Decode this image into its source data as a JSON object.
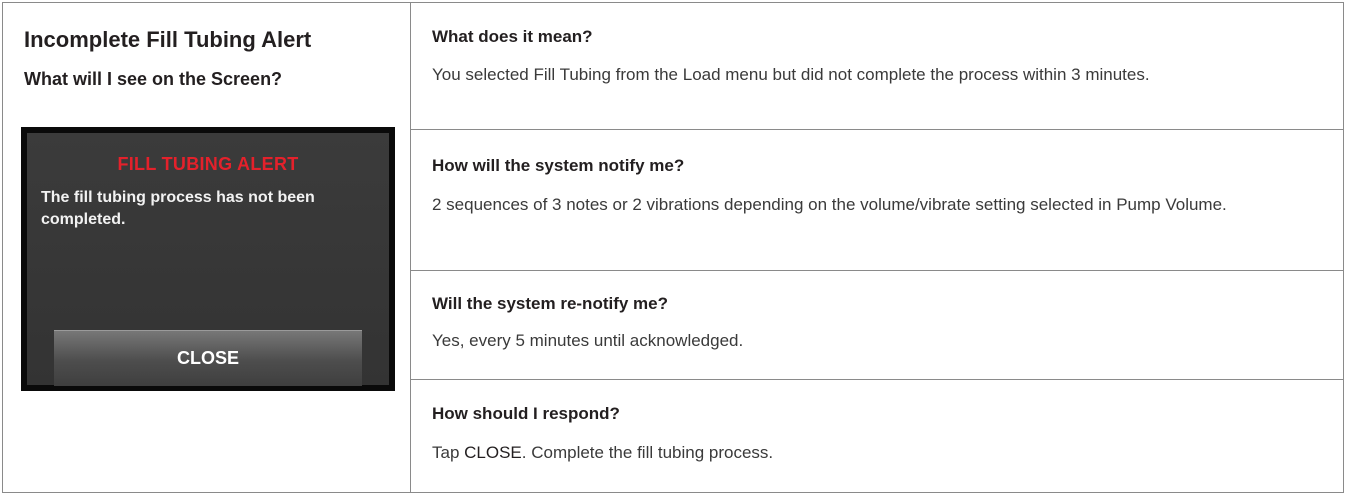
{
  "left": {
    "title": "Incomplete Fill Tubing Alert",
    "screen_question": "What will I see on the Screen?",
    "device": {
      "header": "FILL TUBING ALERT",
      "message": "The fill tubing process has not been completed.",
      "close_label": "CLOSE"
    }
  },
  "sections": [
    {
      "question": "What does it mean?",
      "answer": "You selected Fill Tubing from the Load menu but did not complete the process within 3 minutes."
    },
    {
      "question": "How will the system notify me?",
      "answer": "2 sequences of 3 notes or 2 vibrations depending on the volume/vibrate setting selected in Pump Volume."
    },
    {
      "question": "Will the system re-notify me?",
      "answer": "Yes, every 5 minutes until acknowledged."
    },
    {
      "question": "How should I respond?",
      "answer_prefix": "Tap ",
      "answer_keyword": "CLOSE",
      "answer_suffix": ". Complete the fill tubing process."
    }
  ],
  "colors": {
    "alert_header": "#e4212b",
    "device_bg": "#333333",
    "border": "#8a8a8a"
  }
}
